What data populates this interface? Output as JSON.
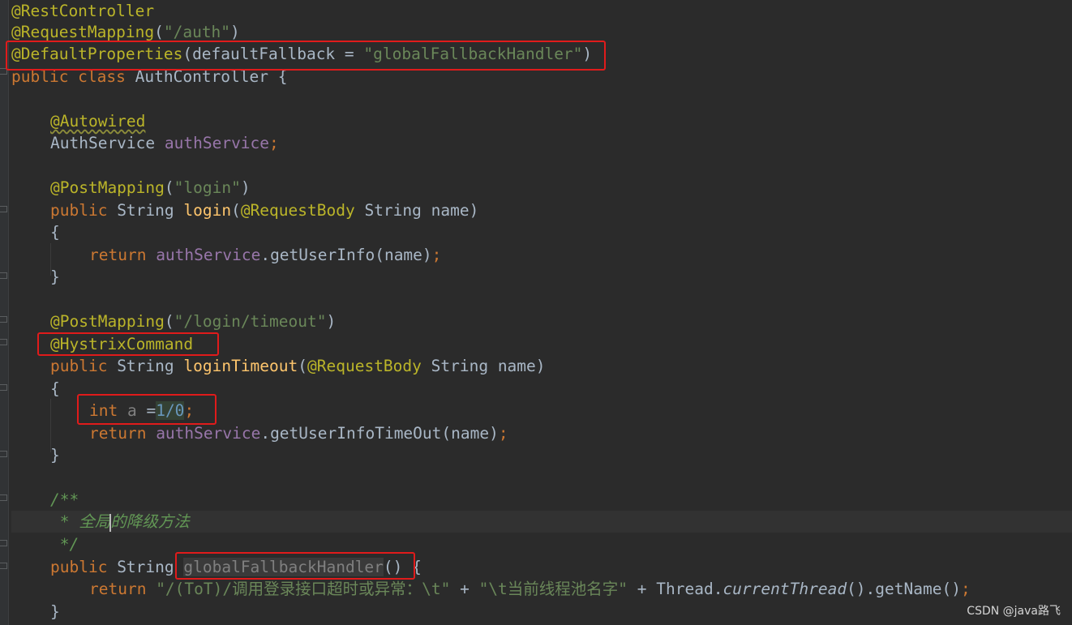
{
  "code": {
    "l1": {
      "a1": "@RestController"
    },
    "l2": {
      "a1": "@RequestMapping",
      "p1": "(",
      "s1": "\"/auth\"",
      "p2": ")"
    },
    "l3": {
      "a1": "@DefaultProperties",
      "p1": "(defaultFallback = ",
      "s1": "\"globalFallbackHandler\"",
      "p2": ")"
    },
    "l4": {
      "k1": "public class ",
      "t1": "AuthController {"
    },
    "l6": {
      "a1": "@Autowired"
    },
    "l7": {
      "t1": "AuthService ",
      "f1": "authService",
      "k1": ";"
    },
    "l9": {
      "a1": "@PostMapping",
      "p1": "(",
      "s1": "\"login\"",
      "p2": ")"
    },
    "l10": {
      "k1": "public ",
      "t1": "String ",
      "m1": "login",
      "p1": "(",
      "a1": "@RequestBody ",
      "t2": "String name)"
    },
    "l11": {
      "t1": "{"
    },
    "l12": {
      "k1": "return ",
      "f1": "authService",
      "t1": ".getUserInfo(name)",
      "k2": ";"
    },
    "l13": {
      "t1": "}"
    },
    "l15": {
      "a1": "@PostMapping",
      "p1": "(",
      "s1": "\"/login/timeout\"",
      "p2": ")"
    },
    "l16": {
      "a1": "@HystrixCommand"
    },
    "l17": {
      "k1": "public ",
      "t1": "String ",
      "m1": "loginTimeout",
      "p1": "(",
      "a1": "@RequestBody ",
      "t2": "String name)"
    },
    "l18": {
      "t1": "{"
    },
    "l19": {
      "k1": "int ",
      "u1": "a",
      "t1": " =",
      "n1": "1/0",
      "k2": ";"
    },
    "l20": {
      "k1": "return ",
      "f1": "authService",
      "t1": ".getUserInfoTimeOut(name)",
      "k2": ";"
    },
    "l21": {
      "t1": "}"
    },
    "l23": {
      "d1": "/**"
    },
    "l24": {
      "d1": " * 全局",
      "d2": "的降级方法"
    },
    "l25": {
      "d1": " */"
    },
    "l26": {
      "k1": "public ",
      "t1": "String ",
      "u1": "globalFallbackHandler",
      "t2": "() {"
    },
    "l27": {
      "k1": "return ",
      "s1": "\"/(ToT)/调用登录接口超时或异常：\\t\"",
      "t1": " + ",
      "s2": "\"\\t当前线程池名字\"",
      "t2": " + Thread.",
      "i1": "currentThread",
      "t3": "().getName()",
      "k2": ";"
    },
    "l28": {
      "t1": "}"
    }
  },
  "watermark": "CSDN @java路飞"
}
